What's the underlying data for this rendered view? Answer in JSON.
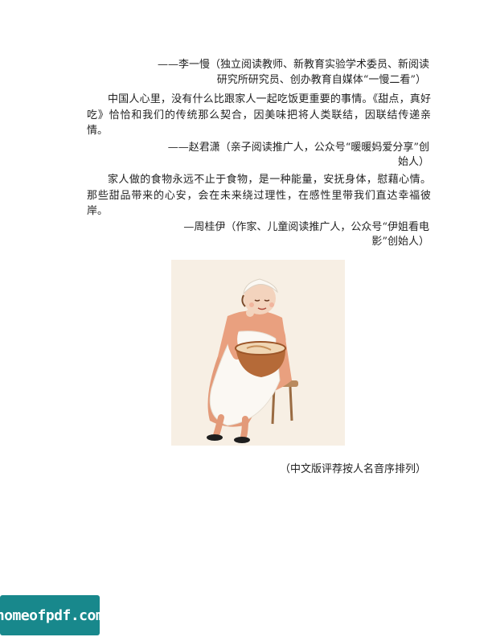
{
  "review1": {
    "attr_line1": "——李一慢（独立阅读教师、新教育实验学术委员、新阅读",
    "attr_line2": "研究所研究员、创办教育自媒体“一慢二看”）"
  },
  "review2": {
    "body": "中国人心里，没有什么比跟家人一起吃饭更重要的事情。《甜点，真好吃》恰恰和我们的传统那么契合，因美味把将人类联结，因联结传递亲情。",
    "attr_line1": "——赵君潇（亲子阅读推广人，公众号“暖暖妈爱分享”创",
    "attr_line2": "始人）"
  },
  "review3": {
    "body": "家人做的食物永远不止于食物，是一种能量，安抚身体，慰藉心情。那些甜品带来的心安，会在未来绕过理性，在感性里带我们直达幸福彼岸。",
    "attr_line1": "—周桂伊（作家、儿童阅读推广人，公众号“伊姐看电",
    "attr_line2": "影”创始人）"
  },
  "caption": "（中文版评荐按人名音序排列）",
  "watermark": "homeofpdf.com",
  "colors": {
    "watermark_bg": "#18888c",
    "figure_bg": "#f7efe4",
    "dress": "#e9a07f"
  }
}
